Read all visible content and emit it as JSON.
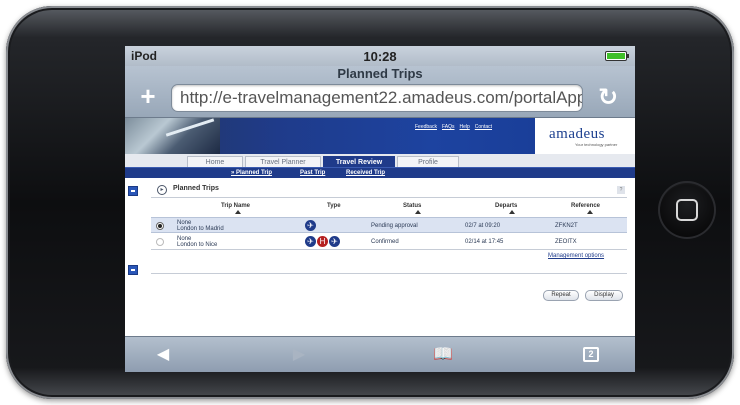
{
  "status_bar": {
    "carrier": "iPod",
    "time": "10:28"
  },
  "browser": {
    "page_title": "Planned Trips",
    "add_label": "+",
    "url": "http://e-travelmanagement22.amadeus.com/portalApp...",
    "reload_label": "↻"
  },
  "site": {
    "header_links": [
      "Feedback",
      "FAQs",
      "Help",
      "Contact"
    ],
    "logo_text": "amadeus",
    "logo_tagline": "Your technology partner",
    "tabs": [
      {
        "label": "Home"
      },
      {
        "label": "Travel Planner"
      },
      {
        "label": "Travel Review",
        "active": true
      },
      {
        "label": "Profile"
      }
    ],
    "subnav": [
      "» Planned Trip",
      "Past Trip",
      "Received Trip"
    ]
  },
  "planned_trips": {
    "title": "Planned Trips",
    "help": "?",
    "columns": [
      "Trip Name",
      "Type",
      "Status",
      "Departs",
      "Reference"
    ],
    "rows": [
      {
        "selected": true,
        "trip_line1": "None",
        "trip_line2": "London to Madrid",
        "status": "Pending approval",
        "departs": "02/7 at 09:20",
        "reference": "ZFKN2T"
      },
      {
        "selected": false,
        "trip_line1": "None",
        "trip_line2": "London to Nice",
        "status": "Confirmed",
        "departs": "02/14 at 17:45",
        "reference": "ZEOITX"
      }
    ],
    "management_options": "Management options",
    "buttons": {
      "repeat": "Repeat",
      "display": "Display"
    }
  },
  "toolbar": {
    "back": "◀",
    "forward": "▶",
    "bookmarks": "📖",
    "pages_count": "2"
  },
  "colors": {
    "brand_blue": "#1f3b8a",
    "selected_row": "#dbe3f2"
  }
}
